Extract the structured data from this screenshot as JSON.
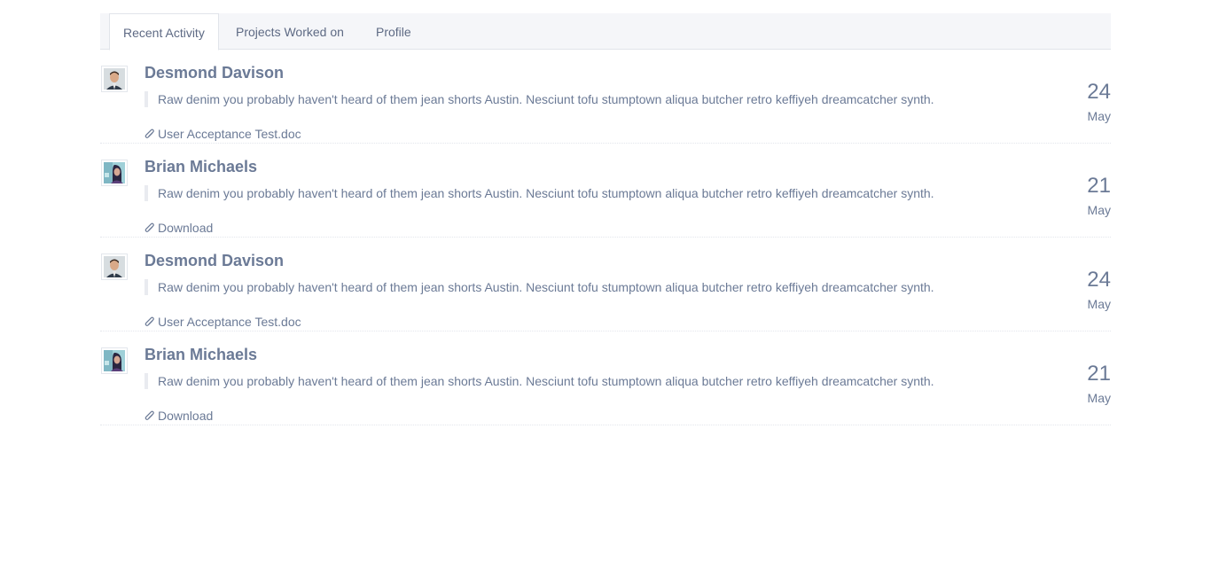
{
  "tabs": [
    {
      "label": "Recent Activity",
      "active": true
    },
    {
      "label": "Projects Worked on",
      "active": false
    },
    {
      "label": "Profile",
      "active": false
    }
  ],
  "feed": [
    {
      "name": "Desmond Davison",
      "avatar": "man-avatar",
      "text": "Raw denim you probably haven't heard of them jean shorts Austin. Nesciunt tofu stumptown aliqua butcher retro keffiyeh dreamcatcher synth.",
      "attachment": "User Acceptance Test.doc",
      "attachment_icon": "paperclip-icon",
      "day": "24",
      "month": "May"
    },
    {
      "name": "Brian Michaels",
      "avatar": "woman-avatar",
      "text": "Raw denim you probably haven't heard of them jean shorts Austin. Nesciunt tofu stumptown aliqua butcher retro keffiyeh dreamcatcher synth.",
      "attachment": "Download",
      "attachment_icon": "paperclip-icon",
      "day": "21",
      "month": "May"
    },
    {
      "name": "Desmond Davison",
      "avatar": "man-avatar",
      "text": "Raw denim you probably haven't heard of them jean shorts Austin. Nesciunt tofu stumptown aliqua butcher retro keffiyeh dreamcatcher synth.",
      "attachment": "User Acceptance Test.doc",
      "attachment_icon": "paperclip-icon",
      "day": "24",
      "month": "May"
    },
    {
      "name": "Brian Michaels",
      "avatar": "woman-avatar",
      "text": "Raw denim you probably haven't heard of them jean shorts Austin. Nesciunt tofu stumptown aliqua butcher retro keffiyeh dreamcatcher synth.",
      "attachment": "Download",
      "attachment_icon": "paperclip-icon",
      "day": "21",
      "month": "May"
    }
  ],
  "colors": {
    "text": "#6b7a96",
    "tabbar_bg": "#f5f6f9",
    "border": "#e1e4ea"
  }
}
